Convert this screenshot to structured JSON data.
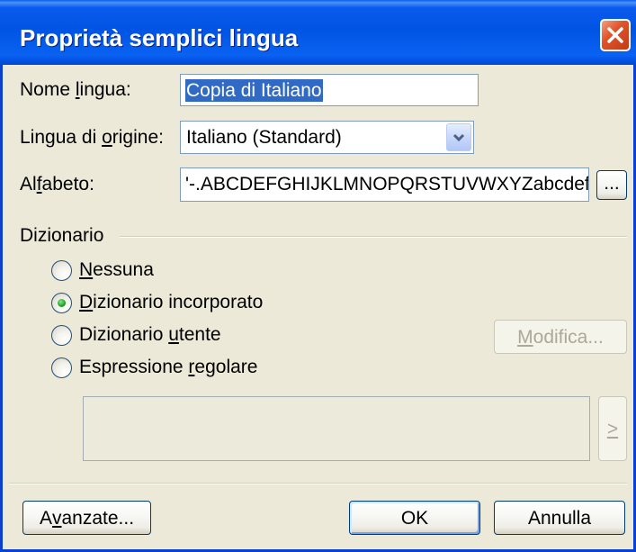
{
  "window": {
    "title": "Proprietà semplici lingua"
  },
  "icons": {
    "close": "close-icon",
    "dropdown": "chevron-down-icon"
  },
  "fields": {
    "name": {
      "label": "Nome lingua:",
      "value": "Copia di Italiano"
    },
    "source_language": {
      "label": "Lingua di origine:",
      "value": "Italiano (Standard)"
    },
    "alphabet": {
      "label": "Alfabeto:",
      "value": "'-.ABCDEFGHIJKLMNOPQRSTUVWXYZabcdefgh",
      "browse_label": "..."
    }
  },
  "dictionary": {
    "group_label": "Dizionario",
    "options": [
      {
        "label": "Nessuna",
        "checked": false
      },
      {
        "label": "Dizionario incorporato",
        "checked": true
      },
      {
        "label": "Dizionario utente",
        "checked": false
      },
      {
        "label": "Espressione regolare",
        "checked": false
      }
    ],
    "edit_button": "Modifica...",
    "insert_button": ">"
  },
  "buttons": {
    "advanced": "Avanzate...",
    "ok": "OK",
    "cancel": "Annulla"
  },
  "colors": {
    "title_bar": "#0054E3",
    "dialog_bg": "#ECE9D8",
    "selection": "#316AC5",
    "radio_dot": "#21A121",
    "close_button": "#E0542B",
    "field_border": "#7F9DB9",
    "disabled_text": "#ACA899"
  }
}
